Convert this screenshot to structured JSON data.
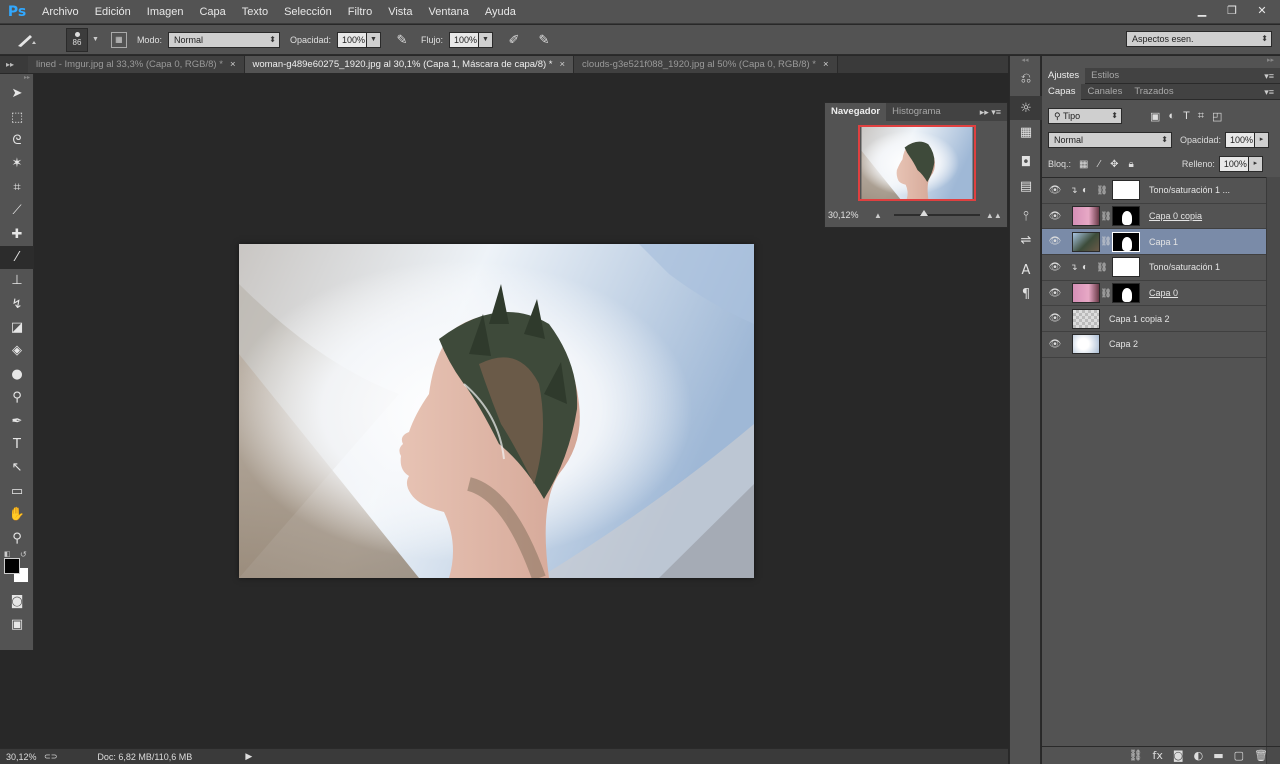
{
  "app": {
    "logo": "Ps"
  },
  "menu": [
    "Archivo",
    "Edición",
    "Imagen",
    "Capa",
    "Texto",
    "Selección",
    "Filtro",
    "Vista",
    "Ventana",
    "Ayuda"
  ],
  "window_controls": {
    "minimize": "▁",
    "restore": "❐",
    "close": "✕"
  },
  "options_bar": {
    "brush_size": "86",
    "mode_label": "Modo:",
    "mode_value": "Normal",
    "opacity_label": "Opacidad:",
    "opacity_value": "100%",
    "flow_label": "Flujo:",
    "flow_value": "100%",
    "workspace": "Aspectos esen."
  },
  "tabs": [
    {
      "label": "lined - Imgur.jpg al 33,3% (Capa 0, RGB/8) *",
      "active": false
    },
    {
      "label": "woman-g489e60275_1920.jpg al 30,1% (Capa 1, Máscara de capa/8) *",
      "active": true
    },
    {
      "label": "clouds-g3e521f088_1920.jpg al 50% (Capa 0, RGB/8) *",
      "active": false
    }
  ],
  "tab_close": "×",
  "navigator": {
    "tab_active": "Navegador",
    "tab_other": "Histograma",
    "zoom": "30,12%"
  },
  "adjust_panel": {
    "tab_active": "Ajustes",
    "tab_other": "Estilos"
  },
  "layers_panel": {
    "tabs": [
      "Capas",
      "Canales",
      "Trazados"
    ],
    "kind": "Tipo",
    "blend_mode": "Normal",
    "opacity_label": "Opacidad:",
    "opacity_value": "100%",
    "lock_label": "Bloq.:",
    "fill_label": "Relleno:",
    "fill_value": "100%",
    "layers": [
      {
        "name": "Tono/saturación 1 ...",
        "type": "adjustment",
        "clipped": true,
        "selected": false,
        "underline": false
      },
      {
        "name": "Capa 0 copia",
        "type": "image-mask",
        "thumb": "pink",
        "selected": false,
        "underline": true
      },
      {
        "name": "Capa 1",
        "type": "image-mask",
        "thumb": "forest",
        "selected": true,
        "underline": false
      },
      {
        "name": "Tono/saturación 1",
        "type": "adjustment",
        "clipped": true,
        "selected": false,
        "underline": false
      },
      {
        "name": "Capa 0",
        "type": "image-mask",
        "thumb": "pink",
        "selected": false,
        "underline": true
      },
      {
        "name": "Capa 1 copia 2",
        "type": "transparent",
        "selected": false,
        "underline": false
      },
      {
        "name": "Capa 2",
        "type": "glow",
        "selected": false,
        "underline": false
      }
    ]
  },
  "status": {
    "zoom": "30,12%",
    "doc": "Doc: 6,82 MB/110,6 MB"
  },
  "colors": {
    "selected_layer": "#7a8ba8",
    "nav_frame": "#e04040",
    "ps_blue": "#31a8ff"
  }
}
